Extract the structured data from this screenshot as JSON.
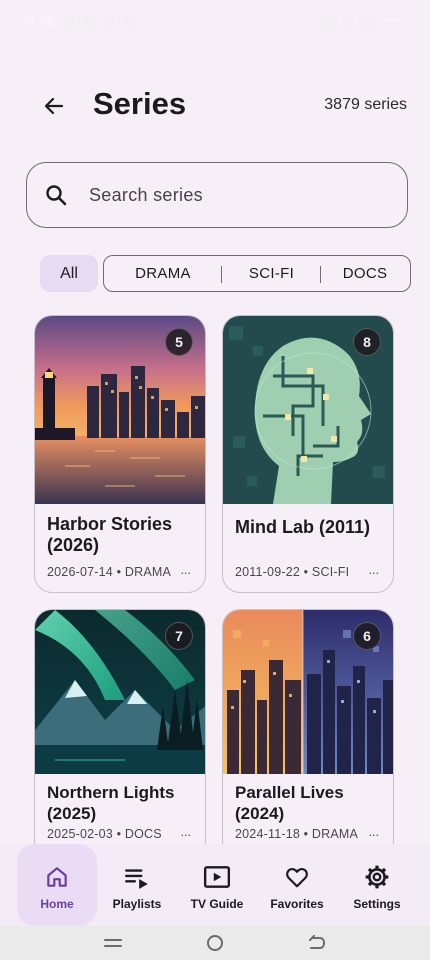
{
  "status_bar": {
    "time": "21:56"
  },
  "header": {
    "title": "Series",
    "count": "3879 series"
  },
  "search": {
    "placeholder": "Search series",
    "value": ""
  },
  "filters": {
    "active": "All",
    "chips": [
      "DRAMA",
      "SCI-FI",
      "DOCS"
    ]
  },
  "cards": [
    {
      "title": "Harbor Stories (2026)",
      "meta": "2026-07-14 • DRAMA",
      "more": "...",
      "badge": "5",
      "image": "harbor-lighthouse-city-image"
    },
    {
      "title": "Mind Lab (2011)",
      "meta": "2011-09-22 • SCI-FI",
      "more": "...",
      "badge": "8",
      "image": "circuit-head-image"
    },
    {
      "title": "Northern Lights (2025)",
      "meta": "2025-02-03 • DOCS",
      "more": "...",
      "badge": "7",
      "image": "aurora-mountains-image"
    },
    {
      "title": "Parallel Lives (2024)",
      "meta": "2024-11-18 • DRAMA",
      "more": "...",
      "badge": "6",
      "image": "split-city-image"
    }
  ],
  "nav": [
    {
      "label": "Home",
      "icon": "home-icon",
      "active": true
    },
    {
      "label": "Playlists",
      "icon": "playlist-icon",
      "active": false
    },
    {
      "label": "TV Guide",
      "icon": "tv-guide-icon",
      "active": false
    },
    {
      "label": "Favorites",
      "icon": "heart-icon",
      "active": false
    },
    {
      "label": "Settings",
      "icon": "gear-icon",
      "active": false
    }
  ],
  "colors": {
    "background": "#f7eff8",
    "accent": "#6b3fa0",
    "chip_active": "#e5dcf3"
  }
}
